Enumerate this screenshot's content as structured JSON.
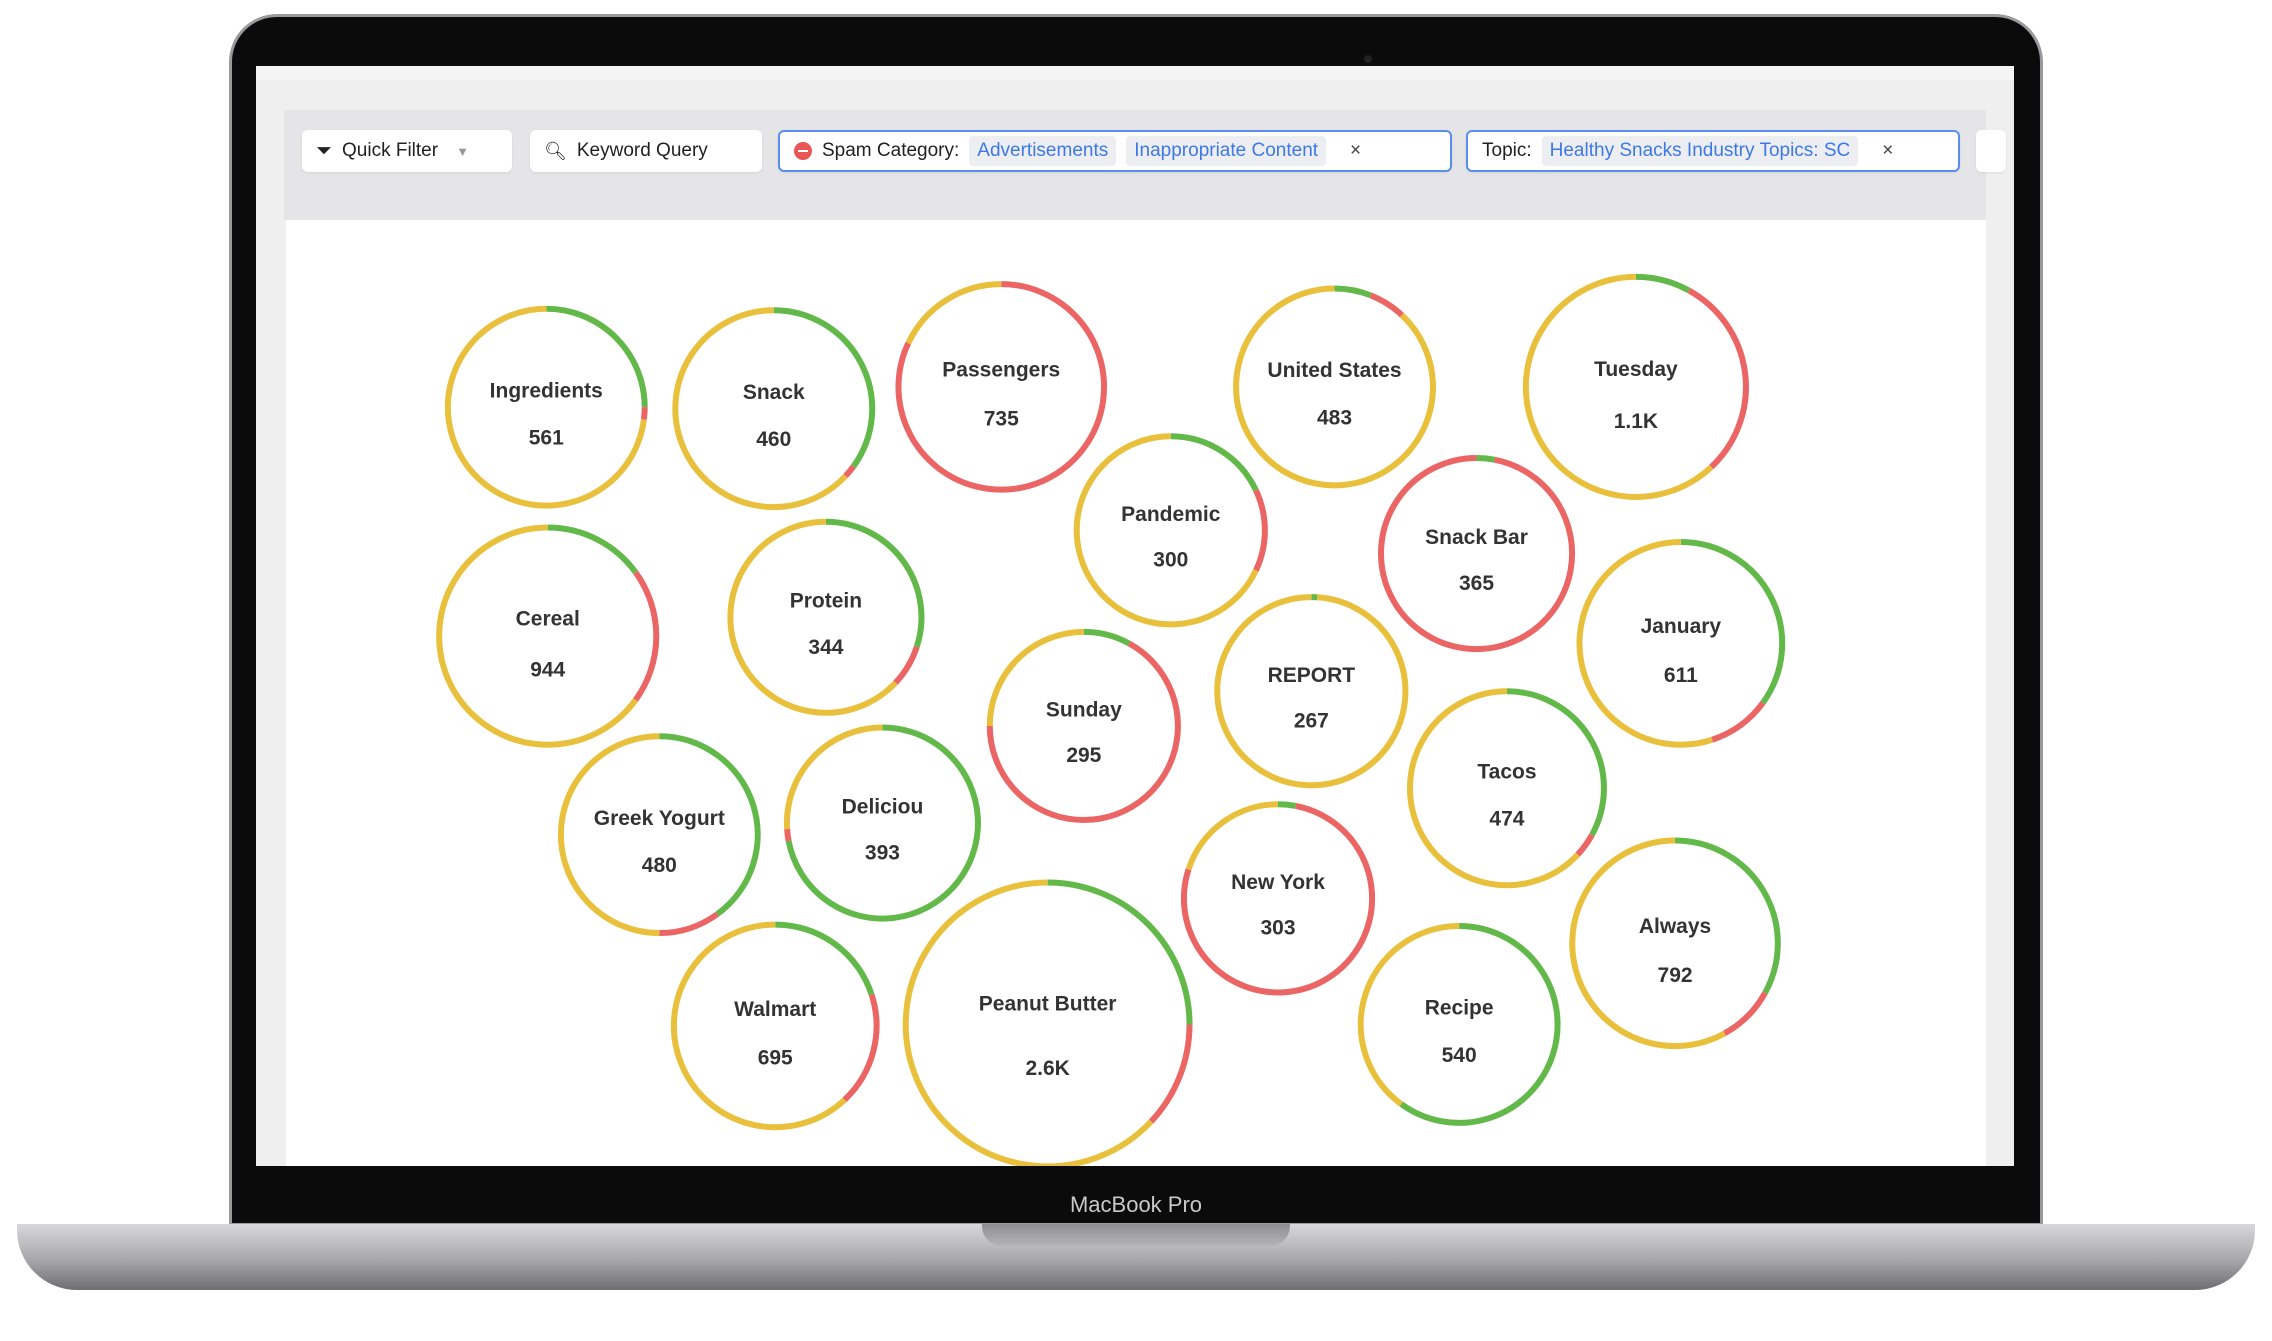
{
  "device_label": "MacBook Pro",
  "filters": {
    "quick_filter": "Quick Filter",
    "keyword_query": "Keyword Query",
    "spam": {
      "label": "Spam Category:",
      "tags": [
        "Advertisements",
        "Inappropriate Content"
      ]
    },
    "topic": {
      "label": "Topic:",
      "tags": [
        "Healthy Snacks Industry Topics: SC"
      ]
    },
    "remove_glyph": "×"
  },
  "colors": {
    "green": "#62b94a",
    "red": "#ec6565",
    "yellow": "#e9c03c",
    "accent": "#3f78e8"
  },
  "bubbles": [
    {
      "label": "Ingredients",
      "value": "561",
      "segments": [
        [
          "green",
          0.25
        ],
        [
          "red",
          0.02
        ],
        [
          "yellow",
          0.73
        ]
      ]
    },
    {
      "label": "Snack",
      "value": "460",
      "segments": [
        [
          "green",
          0.35
        ],
        [
          "red",
          0.02
        ],
        [
          "yellow",
          0.63
        ]
      ]
    },
    {
      "label": "Passengers",
      "value": "735",
      "segments": [
        [
          "red",
          0.82
        ],
        [
          "yellow",
          0.18
        ]
      ]
    },
    {
      "label": "United States",
      "value": "483",
      "segments": [
        [
          "green",
          0.06
        ],
        [
          "red",
          0.06
        ],
        [
          "yellow",
          0.88
        ]
      ]
    },
    {
      "label": "Tuesday",
      "value": "1.1K",
      "segments": [
        [
          "green",
          0.08
        ],
        [
          "red",
          0.3
        ],
        [
          "yellow",
          0.62
        ]
      ]
    },
    {
      "label": "Pandemic",
      "value": "300",
      "segments": [
        [
          "green",
          0.18
        ],
        [
          "red",
          0.14
        ],
        [
          "yellow",
          0.68
        ]
      ]
    },
    {
      "label": "Snack Bar",
      "value": "365",
      "segments": [
        [
          "green",
          0.03
        ],
        [
          "red",
          0.97
        ]
      ]
    },
    {
      "label": "Cereal",
      "value": "944",
      "segments": [
        [
          "green",
          0.15
        ],
        [
          "red",
          0.2
        ],
        [
          "yellow",
          0.65
        ]
      ]
    },
    {
      "label": "Protein",
      "value": "344",
      "segments": [
        [
          "green",
          0.3
        ],
        [
          "red",
          0.07
        ],
        [
          "yellow",
          0.63
        ]
      ]
    },
    {
      "label": "January",
      "value": "611",
      "segments": [
        [
          "green",
          0.35
        ],
        [
          "red",
          0.1
        ],
        [
          "yellow",
          0.55
        ]
      ]
    },
    {
      "label": "Sunday",
      "value": "295",
      "segments": [
        [
          "green",
          0.08
        ],
        [
          "red",
          0.67
        ],
        [
          "yellow",
          0.25
        ]
      ]
    },
    {
      "label": "REPORT",
      "value": "267",
      "segments": [
        [
          "green",
          0.01
        ],
        [
          "yellow",
          0.99
        ]
      ]
    },
    {
      "label": "Tacos",
      "value": "474",
      "segments": [
        [
          "green",
          0.33
        ],
        [
          "red",
          0.04
        ],
        [
          "yellow",
          0.63
        ]
      ]
    },
    {
      "label": "Greek Yogurt",
      "value": "480",
      "segments": [
        [
          "green",
          0.4
        ],
        [
          "red",
          0.1
        ],
        [
          "yellow",
          0.5
        ]
      ]
    },
    {
      "label": "Deliciou",
      "value": "393",
      "segments": [
        [
          "green",
          0.72
        ],
        [
          "red",
          0.02
        ],
        [
          "yellow",
          0.26
        ]
      ]
    },
    {
      "label": "New York",
      "value": "303",
      "segments": [
        [
          "green",
          0.03
        ],
        [
          "red",
          0.77
        ],
        [
          "yellow",
          0.2
        ]
      ]
    },
    {
      "label": "Always",
      "value": "792",
      "segments": [
        [
          "green",
          0.33
        ],
        [
          "red",
          0.09
        ],
        [
          "yellow",
          0.58
        ]
      ]
    },
    {
      "label": "Walmart",
      "value": "695",
      "segments": [
        [
          "green",
          0.2
        ],
        [
          "red",
          0.18
        ],
        [
          "yellow",
          0.62
        ]
      ]
    },
    {
      "label": "Peanut Butter",
      "value": "2.6K",
      "segments": [
        [
          "green",
          0.25
        ],
        [
          "red",
          0.12
        ],
        [
          "yellow",
          0.63
        ]
      ]
    },
    {
      "label": "Recipe",
      "value": "540",
      "segments": [
        [
          "green",
          0.6
        ],
        [
          "yellow",
          0.4
        ]
      ]
    }
  ]
}
